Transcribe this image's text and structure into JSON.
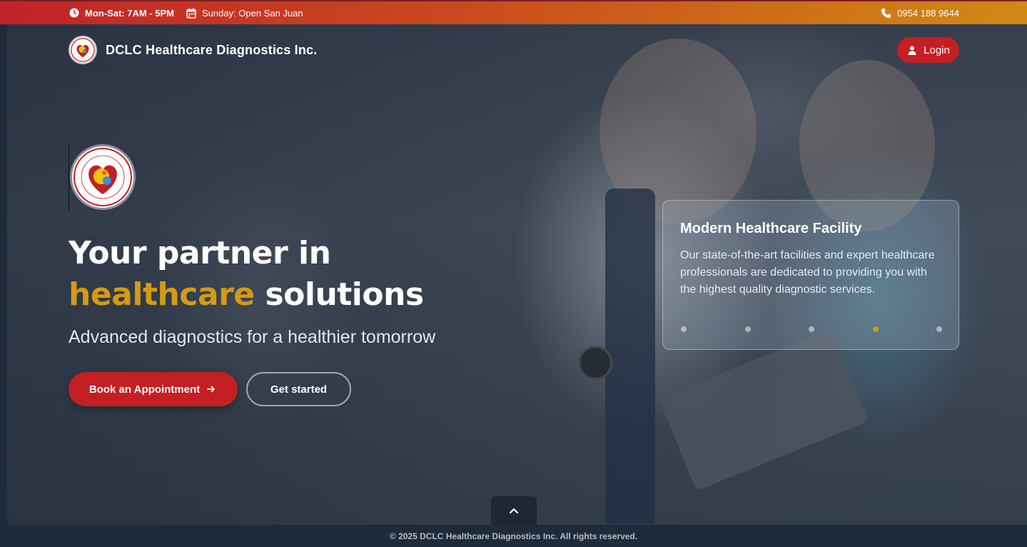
{
  "topbar": {
    "hours": "Mon-Sat: 7AM - 5PM",
    "sunday": "Sunday: Open San Juan",
    "phone": "0954 188 9644",
    "icons": [
      "clock-icon",
      "calendar-icon",
      "phone-icon"
    ]
  },
  "nav": {
    "brand": "DCLC Healthcare Diagnostics Inc.",
    "login_label": "Login"
  },
  "hero": {
    "headline_line1": "Your partner in",
    "headline_accent": "healthcare",
    "headline_rest": "solutions",
    "subtitle": "Advanced diagnostics for a healthier tomorrow",
    "primary_button": "Book an Appointment",
    "secondary_button": "Get started"
  },
  "card": {
    "title": "Modern Healthcare Facility",
    "body": "Our state-of-the-art facilities and expert healthcare professionals are dedicated to providing you with the highest quality diagnostic services.",
    "slides": 5,
    "active_slide": 4
  },
  "footer": {
    "copyright": "© 2025 DCLC Healthcare Diagnostics Inc. All rights reserved."
  },
  "colors": {
    "brand_red": "#c31f24",
    "accent_gold": "#d59a13",
    "footer_bg": "#1f2a3a"
  }
}
